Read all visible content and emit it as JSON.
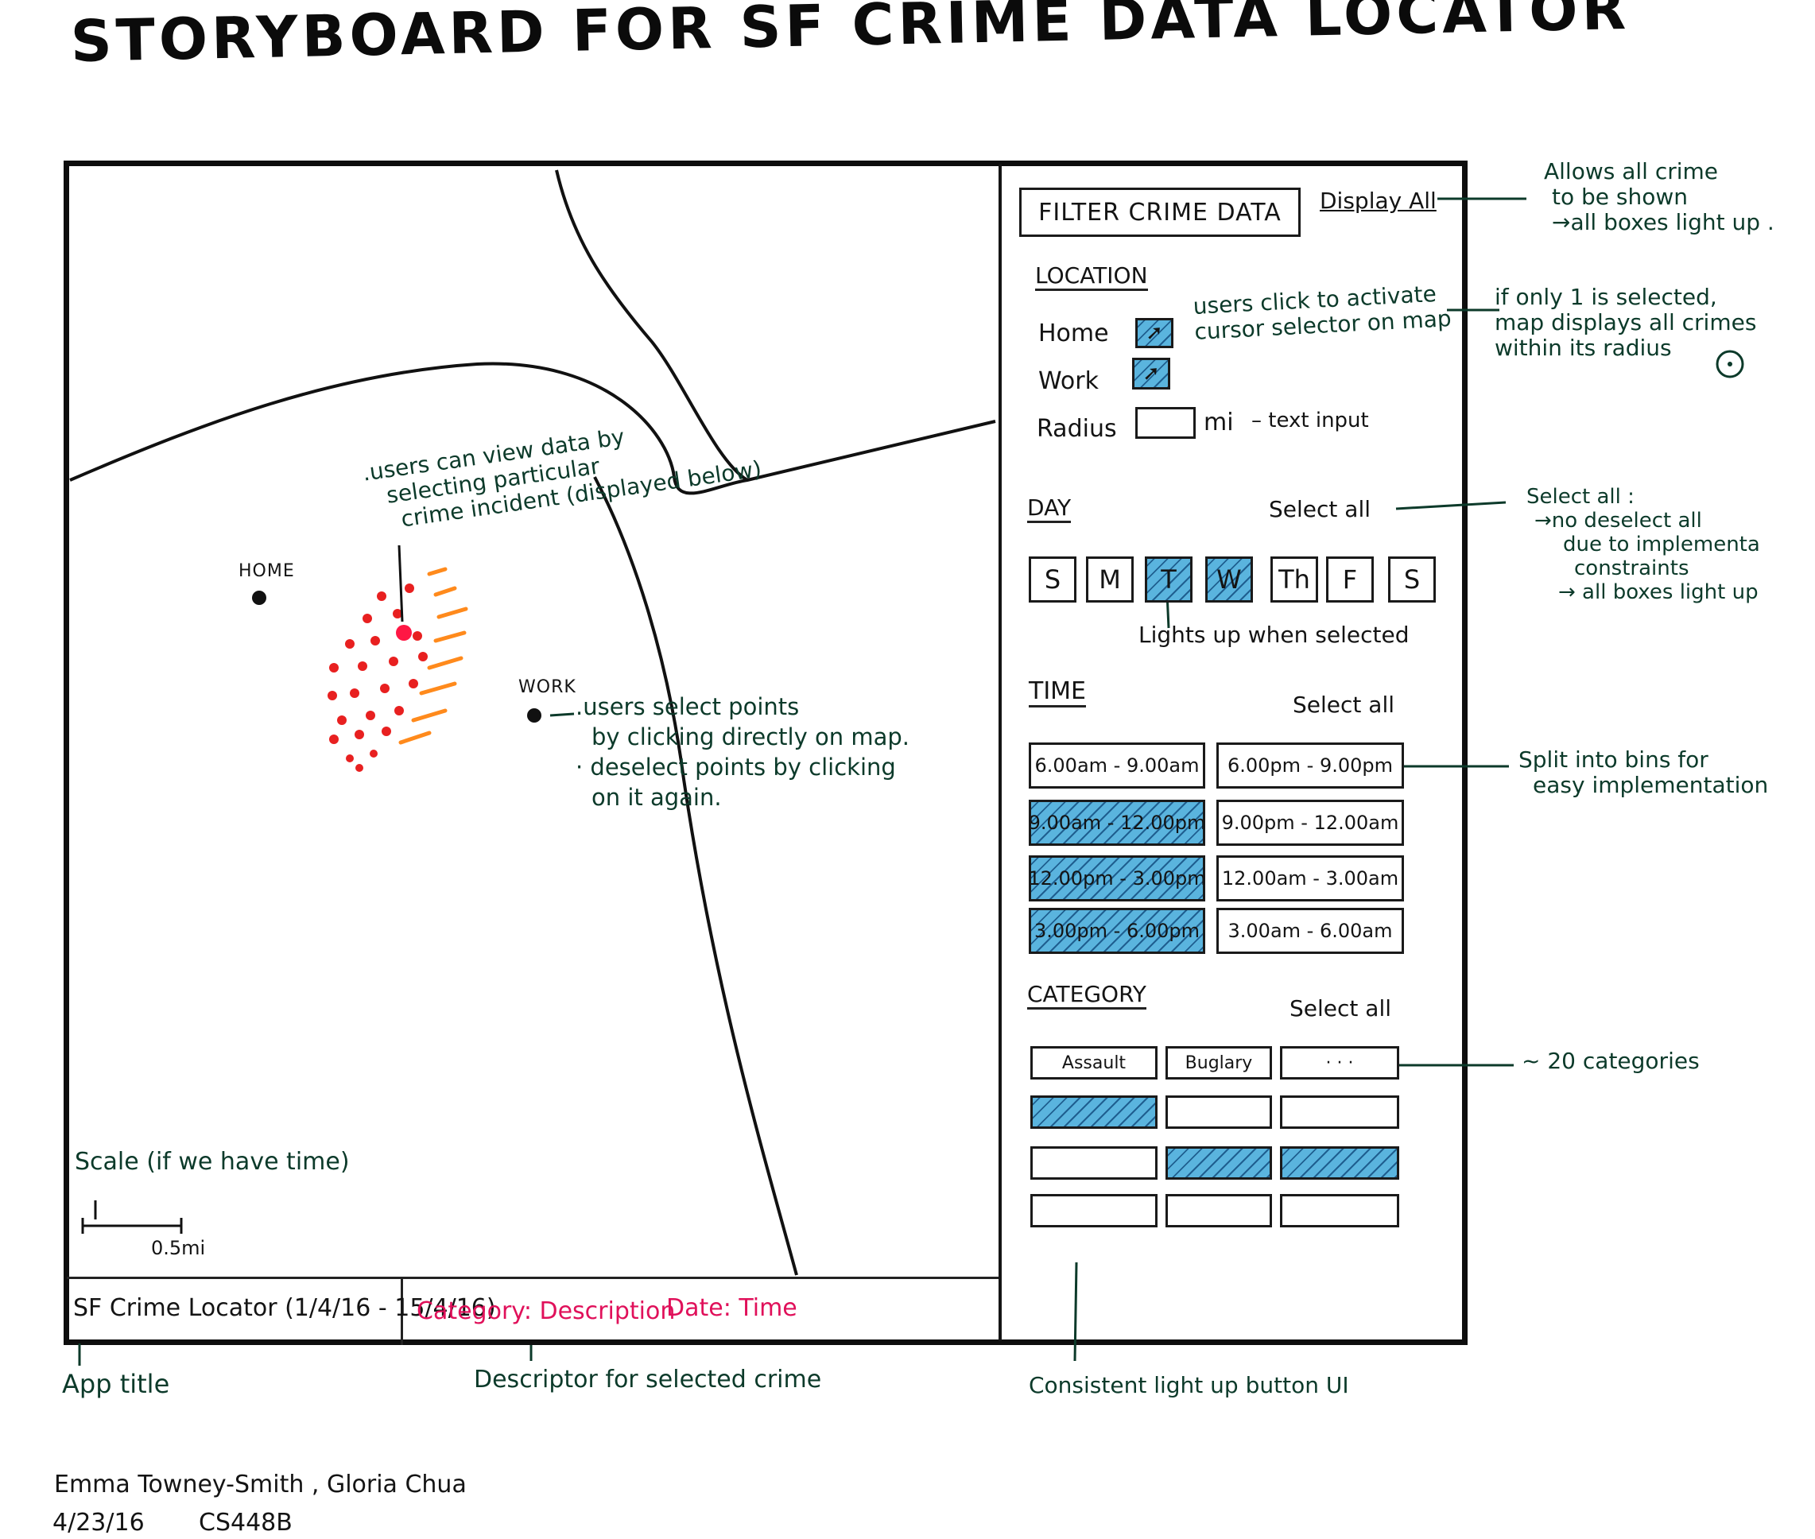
{
  "title": "STORYBOARD FOR SF CRIME DATA LOCATOR",
  "map": {
    "home_label": "HOME",
    "work_label": "WORK",
    "note_view": [
      ".users can view data by",
      "selecting particular",
      "crime incident (displayed below)"
    ],
    "note_select": [
      ".users select points",
      "by clicking directly on map.",
      "· deselect points by clicking",
      "on it again."
    ],
    "scale_note": "Scale (if we have time)",
    "scale_value": "0.5mi"
  },
  "status_bar": {
    "app_title": "SF Crime Locator (1/4/16 - 15/4/16)",
    "category_desc": "Category: Description",
    "date_time": "Date: Time"
  },
  "sidebar": {
    "filter_title": "FILTER CRIME DATA",
    "display_all": "Display All",
    "location": {
      "heading": "LOCATION",
      "home": "Home",
      "work": "Work",
      "radius": "Radius",
      "radius_unit": "mi",
      "radius_note": "– text input",
      "cursor_note": [
        "users click to activate",
        "cursor selector on map"
      ]
    },
    "day": {
      "heading": "DAY",
      "select_all": "Select all",
      "buttons": [
        {
          "label": "S",
          "selected": false
        },
        {
          "label": "M",
          "selected": false
        },
        {
          "label": "T",
          "selected": true
        },
        {
          "label": "W",
          "selected": true
        },
        {
          "label": "Th",
          "selected": false
        },
        {
          "label": "F",
          "selected": false
        },
        {
          "label": "S",
          "selected": false
        }
      ],
      "note": "Lights up when selected"
    },
    "time": {
      "heading": "TIME",
      "select_all": "Select all",
      "left": [
        {
          "label": "6.00am - 9.00am",
          "selected": false
        },
        {
          "label": "9.00am - 12.00pm",
          "selected": true
        },
        {
          "label": "12.00pm - 3.00pm",
          "selected": true
        },
        {
          "label": "3.00pm - 6.00pm",
          "selected": true
        }
      ],
      "right": [
        {
          "label": "6.00pm - 9.00pm",
          "selected": false
        },
        {
          "label": "9.00pm - 12.00am",
          "selected": false
        },
        {
          "label": "12.00am - 3.00am",
          "selected": false
        },
        {
          "label": "3.00am - 6.00am",
          "selected": false
        }
      ]
    },
    "category": {
      "heading": "CATEGORY",
      "select_all": "Select all",
      "rows": [
        [
          {
            "label": "Assault",
            "selected": false
          },
          {
            "label": "Buglary",
            "selected": false
          },
          {
            "label": "· · ·",
            "selected": false
          }
        ],
        [
          {
            "label": "",
            "selected": true
          },
          {
            "label": "",
            "selected": false
          },
          {
            "label": "",
            "selected": false
          }
        ],
        [
          {
            "label": "",
            "selected": false
          },
          {
            "label": "",
            "selected": true
          },
          {
            "label": "",
            "selected": true
          }
        ],
        [
          {
            "label": "",
            "selected": false
          },
          {
            "label": "",
            "selected": false
          },
          {
            "label": "",
            "selected": false
          }
        ]
      ]
    }
  },
  "annotations": {
    "display_all": [
      "Allows all crime",
      "to be shown",
      "→all boxes light up ."
    ],
    "location": [
      "if only 1 is selected,",
      "map displays all crimes",
      "within its radius"
    ],
    "select_all": [
      "Select all :",
      "→no deselect all",
      "due to implementa",
      "constraints",
      "→ all boxes light up"
    ],
    "time_bins": [
      "Split into bins for",
      "easy implementation"
    ],
    "categories": "~ 20 categories",
    "app_title": "App title",
    "descriptor": "Descriptor for selected crime",
    "consistent": "Consistent light up button UI"
  },
  "credits": {
    "authors": "Emma Towney-Smith , Gloria Chua",
    "date": "4/23/16",
    "course": "CS448B"
  },
  "colors": {
    "ink_green": "#0c3a2a",
    "hatch_blue": "#5ab4de",
    "crime_dots": "#e82020",
    "highlight": "#e0105a"
  }
}
